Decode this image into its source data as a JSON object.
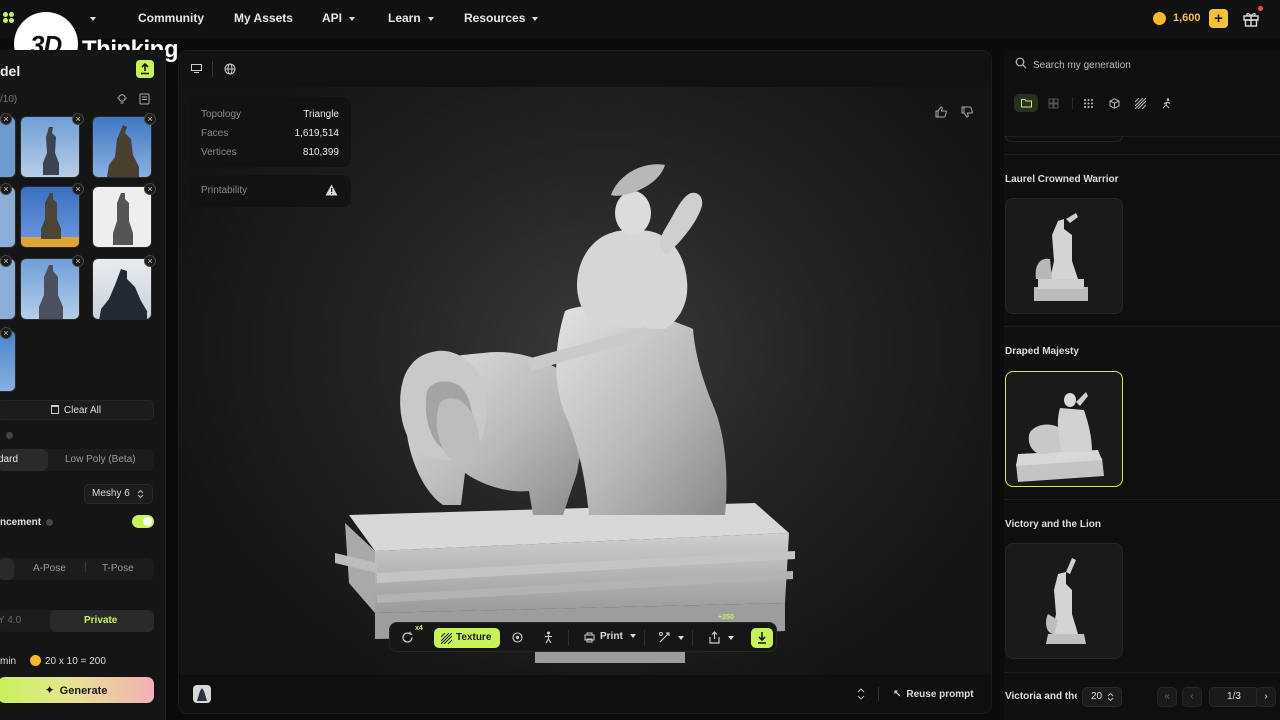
{
  "nav": {
    "brand_text": "3DThinking",
    "items": [
      {
        "label": "Community"
      },
      {
        "label": "My Assets"
      },
      {
        "label": "API"
      },
      {
        "label": "Learn"
      },
      {
        "label": "Resources"
      }
    ],
    "credits": "1,600",
    "add_credits_label": "+"
  },
  "left_panel": {
    "title": "del",
    "image_count": "/10)",
    "clear_all_label": "Clear All",
    "model_types": [
      "dard",
      "Low Poly (Beta)"
    ],
    "model_version": "Meshy 6",
    "enhancement_label": "ncement",
    "poses": [
      "A-Pose",
      "T-Pose"
    ],
    "licenses": [
      "Y 4.0",
      "Private"
    ],
    "time_label": "min",
    "cost_label": "20 x 10 = 200",
    "generate_label": "Generate"
  },
  "viewport": {
    "stats": [
      {
        "key": "Topology",
        "value": "Triangle"
      },
      {
        "key": "Faces",
        "value": "1,619,514"
      },
      {
        "key": "Vertices",
        "value": "810,399"
      }
    ],
    "printability_label": "Printability",
    "toolbar": {
      "remesh_badge": "x4",
      "texture_label": "Texture",
      "print_label": "Print",
      "export_badge": "+250"
    },
    "reuse_prompt_label": "Reuse prompt"
  },
  "right_panel": {
    "search_placeholder": "Search my generation",
    "generations": [
      {
        "title": "Laurel Crowned Warrior"
      },
      {
        "title": "Draped Majesty"
      },
      {
        "title": "Victory and the Lion"
      },
      {
        "title": "Victoria and the"
      }
    ],
    "page_size": "20",
    "page_indicator": "1/3"
  },
  "colors": {
    "accent": "#c7f25a",
    "coin": "#f5b82e",
    "background": "#0b0b0c"
  }
}
